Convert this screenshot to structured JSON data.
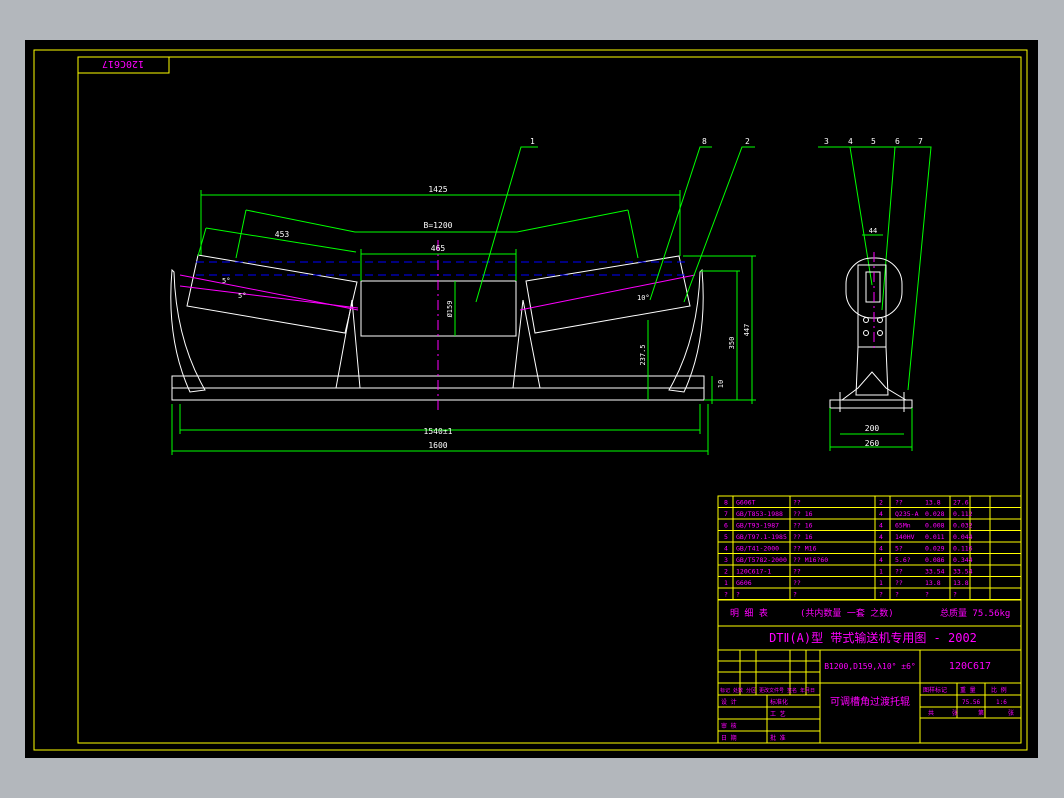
{
  "colors": {
    "background": "#000000",
    "frame": "#ffff00",
    "outline": "#ffffff",
    "dims": "#00ff00",
    "hidden": "#0000ff",
    "center": "#ff00ff",
    "text": "#ff00ff"
  },
  "corner_label": "120C617",
  "dimensions": {
    "overall_top": "1425",
    "belt_width": "B=1200",
    "left_roller": "453",
    "center_roller": "465",
    "roller_dia": "Ø159",
    "height_a": "350",
    "height_b": "447",
    "height_c": "237.5",
    "small_h": "10",
    "base_inner": "1540±1",
    "base_outer": "1600",
    "angle_a": "5°",
    "angle_b": "5°",
    "angle_c": "10°",
    "side_top": "44",
    "side_base_a": "200",
    "side_base_b": "260"
  },
  "leaders": {
    "main": [
      "1",
      "8",
      "2"
    ],
    "side": [
      "3",
      "4",
      "5",
      "6",
      "7"
    ]
  },
  "parts_table": [
    {
      "no": "8",
      "code": "G606T",
      "name": "??",
      "qty": "2",
      "material": "??",
      "unit_w": "13.8",
      "total_w": "27.6"
    },
    {
      "no": "7",
      "code": "GB/T853-1988",
      "name": "?? 16",
      "qty": "4",
      "material": "Q235-A",
      "unit_w": "0.028",
      "total_w": "0.112"
    },
    {
      "no": "6",
      "code": "GB/T93-1987",
      "name": "?? 16",
      "qty": "4",
      "material": "65Mn",
      "unit_w": "0.008",
      "total_w": "0.032"
    },
    {
      "no": "5",
      "code": "GB/T97.1-1985",
      "name": "?? 16",
      "qty": "4",
      "material": "140HV",
      "unit_w": "0.011",
      "total_w": "0.044"
    },
    {
      "no": "4",
      "code": "GB/T41-2000",
      "name": "?? M16",
      "qty": "4",
      "material": "5?",
      "unit_w": "0.029",
      "total_w": "0.116"
    },
    {
      "no": "3",
      "code": "GB/T5782-2000",
      "name": "?? M16?60",
      "qty": "4",
      "material": "5.6?",
      "unit_w": "0.086",
      "total_w": "0.344"
    },
    {
      "no": "2",
      "code": "120C617-1",
      "name": "??",
      "qty": "1",
      "material": "??",
      "unit_w": "33.54",
      "total_w": "33.54"
    },
    {
      "no": "1",
      "code": "G606",
      "name": "??",
      "qty": "1",
      "material": "??",
      "unit_w": "13.8",
      "total_w": "13.8"
    },
    {
      "no": "?",
      "code": "?",
      "name": "?",
      "qty": "?",
      "material": "?",
      "unit_w": "?",
      "total_w": "?"
    }
  ],
  "title_block": {
    "detail_label": "明 细 表",
    "detail_note": "(共内数量 一套 之数)",
    "total_weight": "总质量 75.56kg",
    "series_title": "DTⅡ(A)型 带式输送机专用图 - 2002",
    "spec": "B1200,D159,λ10° ±6°",
    "drawing_no": "120C617",
    "part_name": "可调槽角过渡托辊",
    "std_mark": "图样标记",
    "weight_label": "重 量",
    "scale_label": "比 例",
    "weight_val": "75.56",
    "scale_val": "1:6",
    "sheet_a": "共",
    "sheet_b": "张",
    "sheet_c": "第",
    "sheet_d": "张",
    "rev_header": "标记 处数 分区 更改文件号 签名 年月日",
    "design": "设 计",
    "standard": "标准化",
    "check": "审 核",
    "craft": "工 艺",
    "approve": "批 准",
    "date": "日 期"
  }
}
